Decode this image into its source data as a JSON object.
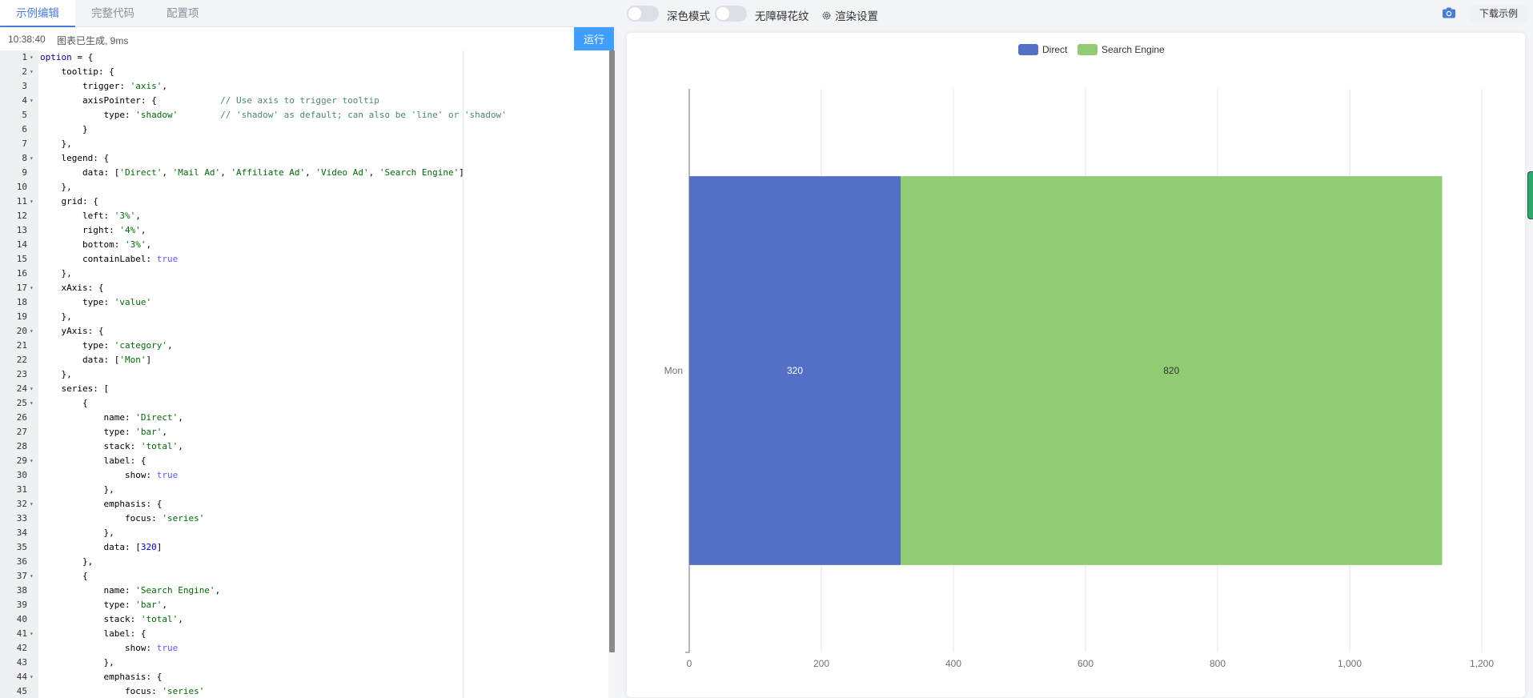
{
  "tabs": [
    {
      "label": "示例编辑",
      "active": true
    },
    {
      "label": "完整代码",
      "active": false
    },
    {
      "label": "配置项",
      "active": false
    }
  ],
  "status": {
    "time": "10:38:40",
    "message": "图表已生成, 9ms"
  },
  "run_label": "运行",
  "toolbar": {
    "dark_mode_label": "深色模式",
    "decal_label": "无障碍花纹",
    "render_settings_label": "渲染设置",
    "download_label": "下载示例"
  },
  "code_lines": [
    {
      "n": 1,
      "fold": true,
      "html": "<span class='kw'>option</span> = {"
    },
    {
      "n": 2,
      "fold": true,
      "html": "    tooltip: {"
    },
    {
      "n": 3,
      "fold": false,
      "html": "        trigger: <span class='str'>'axis'</span>,"
    },
    {
      "n": 4,
      "fold": true,
      "html": "        axisPointer: {            <span class='cm'>// Use axis to trigger tooltip</span>"
    },
    {
      "n": 5,
      "fold": false,
      "html": "            type: <span class='str'>'shadow'</span>        <span class='cm'>// 'shadow' as default; can also be 'line' or 'shadow'</span>"
    },
    {
      "n": 6,
      "fold": false,
      "html": "        }"
    },
    {
      "n": 7,
      "fold": false,
      "html": "    },"
    },
    {
      "n": 8,
      "fold": true,
      "html": "    legend: {"
    },
    {
      "n": 9,
      "fold": false,
      "html": "        data: [<span class='str'>'Direct'</span>, <span class='str'>'Mail Ad'</span>, <span class='str'>'Affiliate Ad'</span>, <span class='str'>'Video Ad'</span>, <span class='str'>'Search Engine'</span>]"
    },
    {
      "n": 10,
      "fold": false,
      "html": "    },"
    },
    {
      "n": 11,
      "fold": true,
      "html": "    grid: {"
    },
    {
      "n": 12,
      "fold": false,
      "html": "        left: <span class='str'>'3%'</span>,"
    },
    {
      "n": 13,
      "fold": false,
      "html": "        right: <span class='str'>'4%'</span>,"
    },
    {
      "n": 14,
      "fold": false,
      "html": "        bottom: <span class='str'>'3%'</span>,"
    },
    {
      "n": 15,
      "fold": false,
      "html": "        containLabel: <span class='bool'>true</span>"
    },
    {
      "n": 16,
      "fold": false,
      "html": "    },"
    },
    {
      "n": 17,
      "fold": true,
      "html": "    xAxis: {"
    },
    {
      "n": 18,
      "fold": false,
      "html": "        type: <span class='str'>'value'</span>"
    },
    {
      "n": 19,
      "fold": false,
      "html": "    },"
    },
    {
      "n": 20,
      "fold": true,
      "html": "    yAxis: {"
    },
    {
      "n": 21,
      "fold": false,
      "html": "        type: <span class='str'>'category'</span>,"
    },
    {
      "n": 22,
      "fold": false,
      "html": "        data: [<span class='str'>'Mon'</span>]"
    },
    {
      "n": 23,
      "fold": false,
      "html": "    },"
    },
    {
      "n": 24,
      "fold": true,
      "html": "    series: ["
    },
    {
      "n": 25,
      "fold": true,
      "html": "        {"
    },
    {
      "n": 26,
      "fold": false,
      "html": "            name: <span class='str'>'Direct'</span>,"
    },
    {
      "n": 27,
      "fold": false,
      "html": "            type: <span class='str'>'bar'</span>,"
    },
    {
      "n": 28,
      "fold": false,
      "html": "            stack: <span class='str'>'total'</span>,"
    },
    {
      "n": 29,
      "fold": true,
      "html": "            label: {"
    },
    {
      "n": 30,
      "fold": false,
      "html": "                show: <span class='bool'>true</span>"
    },
    {
      "n": 31,
      "fold": false,
      "html": "            },"
    },
    {
      "n": 32,
      "fold": true,
      "html": "            emphasis: {"
    },
    {
      "n": 33,
      "fold": false,
      "html": "                focus: <span class='str'>'series'</span>"
    },
    {
      "n": 34,
      "fold": false,
      "html": "            },"
    },
    {
      "n": 35,
      "fold": false,
      "html": "            data: [<span class='num'>320</span>]"
    },
    {
      "n": 36,
      "fold": false,
      "html": "        },"
    },
    {
      "n": 37,
      "fold": true,
      "html": "        {"
    },
    {
      "n": 38,
      "fold": false,
      "html": "            name: <span class='str'>'Search Engine'</span>,"
    },
    {
      "n": 39,
      "fold": false,
      "html": "            type: <span class='str'>'bar'</span>,"
    },
    {
      "n": 40,
      "fold": false,
      "html": "            stack: <span class='str'>'total'</span>,"
    },
    {
      "n": 41,
      "fold": true,
      "html": "            label: {"
    },
    {
      "n": 42,
      "fold": false,
      "html": "                show: <span class='bool'>true</span>"
    },
    {
      "n": 43,
      "fold": false,
      "html": "            },"
    },
    {
      "n": 44,
      "fold": true,
      "html": "            emphasis: {"
    },
    {
      "n": 45,
      "fold": false,
      "html": "                focus: <span class='str'>'series'</span>"
    }
  ],
  "colors": {
    "direct": "#5470c6",
    "search_engine": "#91cc75",
    "accent": "#409eff"
  },
  "chart_data": {
    "type": "bar",
    "orientation": "horizontal",
    "stacked": true,
    "categories": [
      "Mon"
    ],
    "series": [
      {
        "name": "Direct",
        "values": [
          320
        ],
        "color": "#5470c6"
      },
      {
        "name": "Search Engine",
        "values": [
          820
        ],
        "color": "#91cc75"
      }
    ],
    "xlim": [
      0,
      1200
    ],
    "xticks": [
      0,
      200,
      400,
      600,
      800,
      1000,
      1200
    ],
    "xtick_labels": [
      "0",
      "200",
      "400",
      "600",
      "800",
      "1,000",
      "1,200"
    ],
    "legend_position": "top-center",
    "grid": true
  }
}
